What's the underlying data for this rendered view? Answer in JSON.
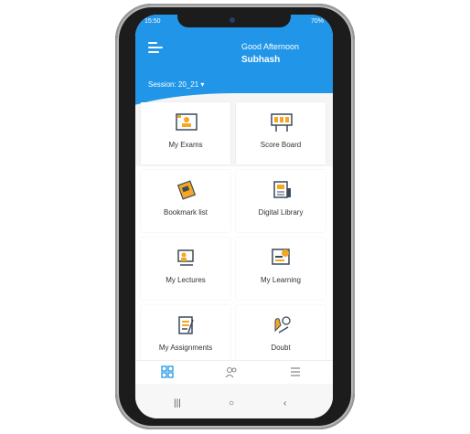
{
  "status_bar": {
    "time": "15:50",
    "right": "70%"
  },
  "header": {
    "greeting": "Good Afternoon",
    "username": "Subhash",
    "session": "Session: 20_21 ▾",
    "menu_icon": "hamburger-icon"
  },
  "tiles": [
    {
      "label": "My Exams",
      "icon": "exam-icon"
    },
    {
      "label": "Score Board",
      "icon": "scoreboard-icon"
    },
    {
      "label": "Bookmark list",
      "icon": "bookmark-icon"
    },
    {
      "label": "Digital Library",
      "icon": "library-icon"
    },
    {
      "label": "My Lectures",
      "icon": "lecture-icon"
    },
    {
      "label": "My Learning",
      "icon": "learning-icon"
    },
    {
      "label": "My Assignments",
      "icon": "assignment-icon"
    },
    {
      "label": "Doubt",
      "icon": "doubt-icon"
    }
  ],
  "bottom_nav": [
    {
      "name": "grid-icon",
      "active": true
    },
    {
      "name": "people-icon",
      "active": false
    },
    {
      "name": "menu-lines-icon",
      "active": false
    }
  ],
  "system_nav": {
    "recent": "|||",
    "home": "○",
    "back": "‹"
  },
  "colors": {
    "primary": "#2196e8",
    "icon_accent": "#f5a623",
    "icon_dark": "#3a4a5a"
  }
}
